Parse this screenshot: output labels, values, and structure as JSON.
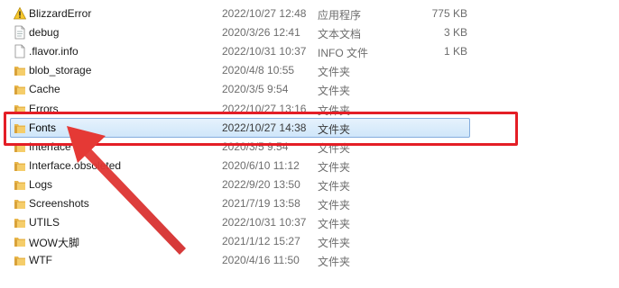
{
  "files": [
    {
      "name": "BlizzardError",
      "date": "2022/10/27 12:48",
      "type": "应用程序",
      "size": "775 KB",
      "icon": "warning-icon",
      "selected": false
    },
    {
      "name": "debug",
      "date": "2020/3/26 12:41",
      "type": "文本文档",
      "size": "3 KB",
      "icon": "text-file-icon",
      "selected": false
    },
    {
      "name": ".flavor.info",
      "date": "2022/10/31 10:37",
      "type": "INFO 文件",
      "size": "1 KB",
      "icon": "file-icon",
      "selected": false
    },
    {
      "name": "blob_storage",
      "date": "2020/4/8 10:55",
      "type": "文件夹",
      "size": "",
      "icon": "folder-icon",
      "selected": false
    },
    {
      "name": "Cache",
      "date": "2020/3/5 9:54",
      "type": "文件夹",
      "size": "",
      "icon": "folder-icon",
      "selected": false
    },
    {
      "name": "Errors",
      "date": "2022/10/27 13:16",
      "type": "文件夹",
      "size": "",
      "icon": "folder-icon",
      "selected": false
    },
    {
      "name": "Fonts",
      "date": "2022/10/27 14:38",
      "type": "文件夹",
      "size": "",
      "icon": "folder-icon",
      "selected": true
    },
    {
      "name": "Interface",
      "date": "2020/3/5 9:54",
      "type": "文件夹",
      "size": "",
      "icon": "folder-icon",
      "selected": false
    },
    {
      "name": "Interface.obsoleted",
      "date": "2020/6/10 11:12",
      "type": "文件夹",
      "size": "",
      "icon": "folder-icon",
      "selected": false
    },
    {
      "name": "Logs",
      "date": "2022/9/20 13:50",
      "type": "文件夹",
      "size": "",
      "icon": "folder-icon",
      "selected": false
    },
    {
      "name": "Screenshots",
      "date": "2021/7/19 13:58",
      "type": "文件夹",
      "size": "",
      "icon": "folder-icon",
      "selected": false
    },
    {
      "name": "UTILS",
      "date": "2022/10/31 10:37",
      "type": "文件夹",
      "size": "",
      "icon": "folder-icon",
      "selected": false
    },
    {
      "name": "WOW大脚",
      "date": "2021/1/12 15:27",
      "type": "文件夹",
      "size": "",
      "icon": "folder-icon",
      "selected": false
    },
    {
      "name": "WTF",
      "date": "2020/4/16 11:50",
      "type": "文件夹",
      "size": "",
      "icon": "folder-icon",
      "selected": false
    }
  ],
  "colors": {
    "highlight": "#e41e26",
    "arrow": "#e53935",
    "selection": "#cfe6fa",
    "folder": "#e8b64a"
  }
}
